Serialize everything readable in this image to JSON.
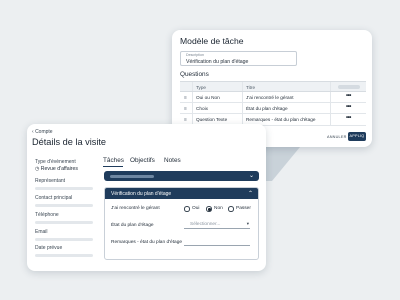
{
  "template_card": {
    "title": "Modèle de tâche",
    "description_label": "Description",
    "description_value": "Vérification du plan d'étage",
    "questions_heading": "Questions",
    "columns": {
      "type": "Type",
      "title": "Titre"
    },
    "rows": [
      {
        "type": "Oui ou Non",
        "title": "J'ai rencontré le gérant"
      },
      {
        "type": "Choix",
        "title": "État du plan d'étage"
      },
      {
        "type": "Question Texte",
        "title": "Remarques - état du plan d'étage"
      }
    ],
    "more_icon": "more-horizontal-icon",
    "drag_icon": "drag-handle-icon",
    "cancel_label": "ANNULER",
    "apply_label": "APPLIQ"
  },
  "visit_card": {
    "back_label": "Compte",
    "title": "Détails de la visite",
    "fields": {
      "event_type_label": "Type d'évènement",
      "event_type_value": "Revue d'affaires",
      "representative_label": "Représentant",
      "contact_label": "Contact principal",
      "phone_label": "Téléphone",
      "email_label": "Email",
      "date_label": "Date prévue"
    },
    "tabs": [
      "Tâches",
      "Objectifs",
      "Notes"
    ],
    "task_panel": {
      "header": "Vérification du plan d'étage",
      "q1_label": "J'ai rencontré le gérant",
      "q1_options": [
        "Oui",
        "Non",
        "Passer"
      ],
      "q1_selected": "Non",
      "q2_label": "État du plan d'étage",
      "q2_placeholder": "Sélectionner...",
      "q3_label": "Remarques - état du plan d'étage"
    }
  },
  "colors": {
    "accent": "#1f3c5c",
    "background": "#eceff1"
  }
}
